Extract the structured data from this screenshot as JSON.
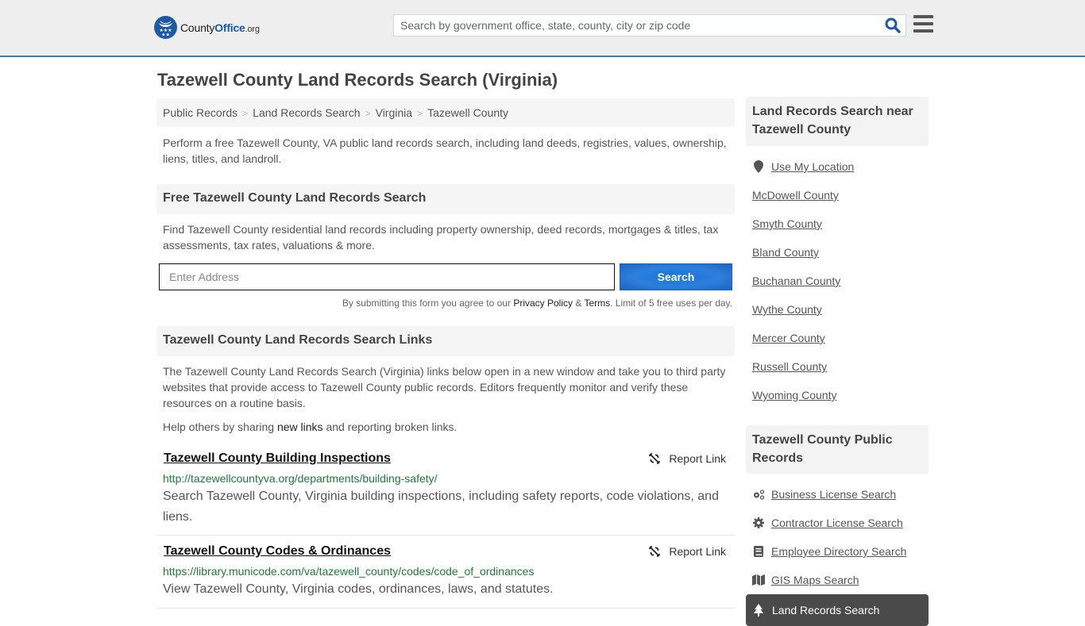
{
  "header": {
    "logo": {
      "prefix": "County",
      "brand": "Office",
      "suffix": ".org"
    },
    "search": {
      "placeholder": "Search by government office, state, county, city or zip code",
      "value": ""
    },
    "search_icon": "search-icon",
    "menu_icon": "hamburger-menu-icon"
  },
  "page": {
    "title": "Tazewell County Land Records Search (Virginia)",
    "breadcrumb": [
      {
        "label": "Public Records"
      },
      {
        "label": "Land Records Search"
      },
      {
        "label": "Virginia"
      },
      {
        "label": "Tazewell County"
      }
    ],
    "breadcrumb_separator": ">",
    "intro": "Perform a free Tazewell County, VA public land records search, including land deeds, registries, values, ownership, liens, titles, and landroll."
  },
  "free_search": {
    "heading": "Free Tazewell County Land Records Search",
    "description": "Find Tazewell County residential land records including property ownership, deed records, mortgages & titles, tax assessments, tax rates, valuations & more.",
    "address_placeholder": "Enter Address",
    "address_value": "",
    "button_label": "Search",
    "disclaimer_prefix": "By submitting this form you agree to our ",
    "privacy_label": "Privacy Policy",
    "amp": " & ",
    "terms_label": "Terms",
    "disclaimer_suffix": ". Limit of 5 free uses per day."
  },
  "links_section": {
    "heading": "Tazewell County Land Records Search Links",
    "description": "The Tazewell County Land Records Search (Virginia) links below open in a new window and take you to third party websites that provide access to Tazewell County public records. Editors frequently monitor and verify these resources on a routine basis.",
    "help_prefix": "Help others by sharing ",
    "help_link": "new links",
    "help_suffix": " and reporting broken links.",
    "report_label": "Report Link",
    "items": [
      {
        "title": "Tazewell County Building Inspections",
        "url": "http://tazewellcountyva.org/departments/building-safety/",
        "description": "Search Tazewell County, Virginia building inspections, including safety reports, code violations, and liens."
      },
      {
        "title": "Tazewell County Codes & Ordinances",
        "url": "https://library.municode.com/va/tazewell_county/codes/code_of_ordinances",
        "description": "View Tazewell County, Virginia codes, ordinances, laws, and statutes."
      }
    ]
  },
  "sidebar": {
    "nearby_heading": "Land Records Search near Tazewell County",
    "use_location": "Use My Location",
    "nearby": [
      "McDowell County",
      "Smyth County",
      "Bland County",
      "Buchanan County",
      "Wythe County",
      "Mercer County",
      "Russell County",
      "Wyoming County"
    ],
    "public_heading": "Tazewell County Public Records",
    "public_records": [
      {
        "label": "Business License Search",
        "icon": "gears-icon"
      },
      {
        "label": "Contractor License Search",
        "icon": "gear-icon"
      },
      {
        "label": "Employee Directory Search",
        "icon": "book-icon"
      },
      {
        "label": "GIS Maps Search",
        "icon": "map-icon"
      }
    ],
    "active_item": {
      "label": "Land Records Search",
      "icon": "tree-icon"
    }
  }
}
